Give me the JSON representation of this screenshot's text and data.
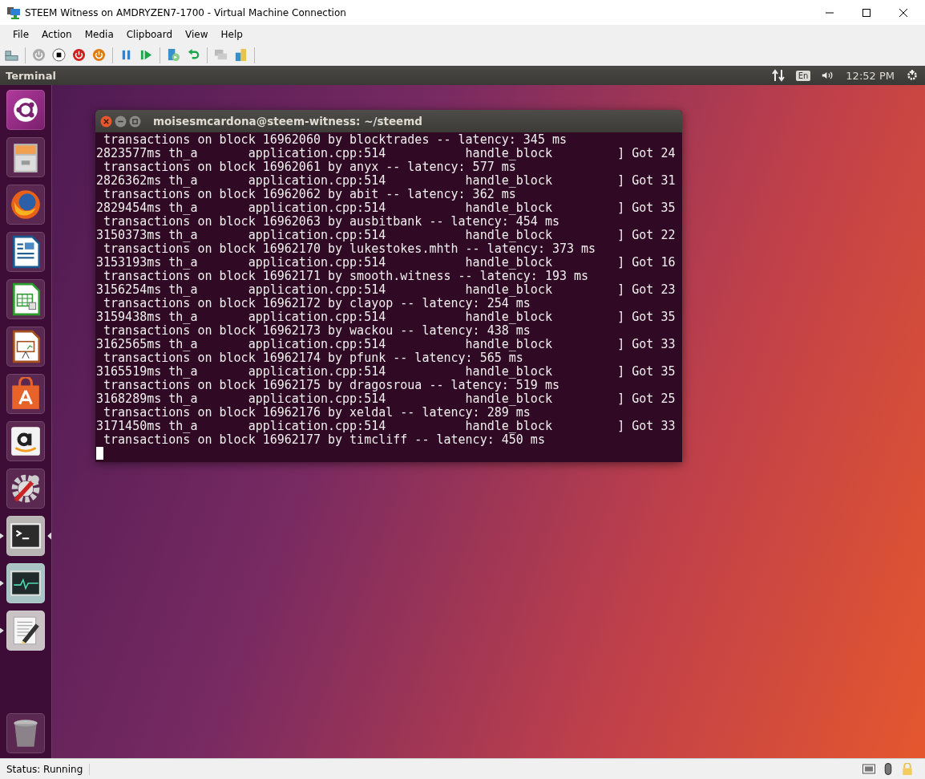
{
  "window": {
    "title": "STEEM Witness on AMDRYZEN7-1700 - Virtual Machine Connection"
  },
  "menu": [
    "File",
    "Action",
    "Media",
    "Clipboard",
    "View",
    "Help"
  ],
  "top_panel": {
    "app_title": "Terminal",
    "keyboard_layout": "En",
    "clock": "12:52 PM"
  },
  "launcher": [
    {
      "kind": "dash",
      "running": false,
      "focused": false
    },
    {
      "kind": "files",
      "running": false,
      "focused": false
    },
    {
      "kind": "browser",
      "running": false,
      "focused": false
    },
    {
      "kind": "writer",
      "running": false,
      "focused": false
    },
    {
      "kind": "calc",
      "running": false,
      "focused": false
    },
    {
      "kind": "impress",
      "running": false,
      "focused": false
    },
    {
      "kind": "software",
      "running": false,
      "focused": false
    },
    {
      "kind": "amazon",
      "running": false,
      "focused": false
    },
    {
      "kind": "settings",
      "running": false,
      "focused": false
    },
    {
      "kind": "terminal",
      "running": true,
      "focused": true
    },
    {
      "kind": "monitor",
      "running": true,
      "focused": false
    },
    {
      "kind": "editor",
      "running": true,
      "focused": false
    }
  ],
  "terminal": {
    "title": "moisesmcardona@steem-witness: ~/steemd",
    "lines": [
      " transactions on block 16962060 by blocktrades -- latency: 345 ms",
      "2823577ms th_a       application.cpp:514           handle_block         ] Got 24",
      " transactions on block 16962061 by anyx -- latency: 577 ms",
      "2826362ms th_a       application.cpp:514           handle_block         ] Got 31",
      " transactions on block 16962062 by abit -- latency: 362 ms",
      "2829454ms th_a       application.cpp:514           handle_block         ] Got 35",
      " transactions on block 16962063 by ausbitbank -- latency: 454 ms",
      "3150373ms th_a       application.cpp:514           handle_block         ] Got 22",
      " transactions on block 16962170 by lukestokes.mhth -- latency: 373 ms",
      "3153193ms th_a       application.cpp:514           handle_block         ] Got 16",
      " transactions on block 16962171 by smooth.witness -- latency: 193 ms",
      "3156254ms th_a       application.cpp:514           handle_block         ] Got 23",
      " transactions on block 16962172 by clayop -- latency: 254 ms",
      "3159438ms th_a       application.cpp:514           handle_block         ] Got 35",
      " transactions on block 16962173 by wackou -- latency: 438 ms",
      "3162565ms th_a       application.cpp:514           handle_block         ] Got 33",
      " transactions on block 16962174 by pfunk -- latency: 565 ms",
      "3165519ms th_a       application.cpp:514           handle_block         ] Got 35",
      " transactions on block 16962175 by dragosroua -- latency: 519 ms",
      "3168289ms th_a       application.cpp:514           handle_block         ] Got 25",
      " transactions on block 16962176 by xeldal -- latency: 289 ms",
      "3171450ms th_a       application.cpp:514           handle_block         ] Got 33",
      " transactions on block 16962177 by timcliff -- latency: 450 ms"
    ]
  },
  "status_bar": {
    "status": "Status: Running"
  }
}
